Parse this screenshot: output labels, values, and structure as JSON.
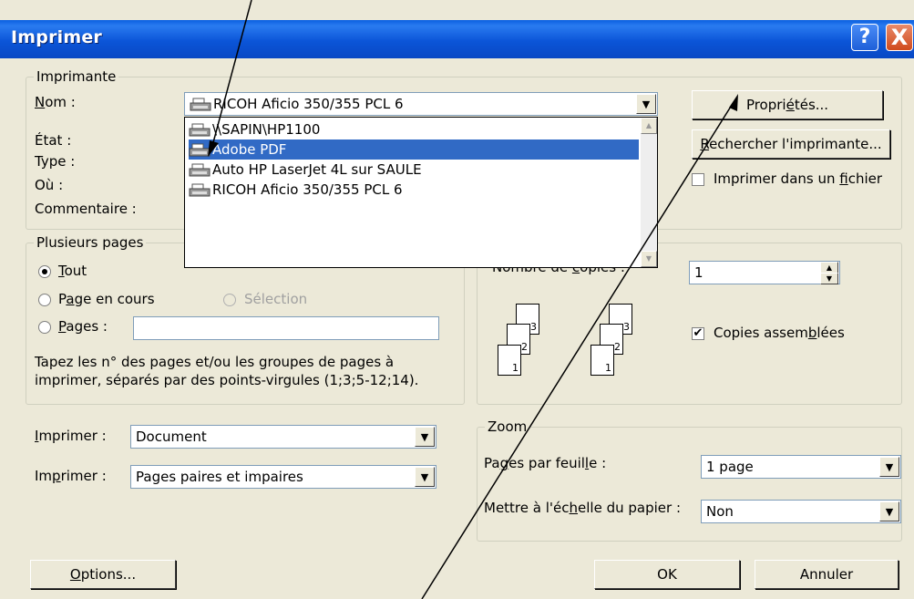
{
  "window": {
    "title": "Imprimer",
    "help": "?",
    "close": "X"
  },
  "printer": {
    "legend": "Imprimante",
    "name_label_u": "N",
    "name_label_rest": "om :",
    "name_value": "RICOH Aficio 350/355 PCL 6",
    "state_label": "État :",
    "type_label": "Type :",
    "where_label": "Où :",
    "comment_label": "Commentaire :",
    "properties_pre": "Propri",
    "properties_u": "é",
    "properties_post": "tés...",
    "find_u": "R",
    "find_rest": "echercher l'imprimante...",
    "print_to_file_pre": "Imprimer dans un ",
    "print_to_file_u": "f",
    "print_to_file_post": "ichier",
    "dropdown_items": [
      {
        "label": "\\\\SAPIN\\HP1100",
        "selected": false
      },
      {
        "label": "Adobe PDF",
        "selected": true
      },
      {
        "label": "Auto HP LaserJet 4L sur SAULE",
        "selected": false
      },
      {
        "label": "RICOH Aficio 350/355 PCL 6",
        "selected": false
      }
    ]
  },
  "pages": {
    "legend": "Plusieurs pages",
    "all_u": "T",
    "all_rest": "out",
    "current_pre": "P",
    "current_u": "a",
    "current_post": "ge en cours",
    "selection": "Sélection",
    "pages_u": "P",
    "pages_rest": "ages :",
    "hint_line1": "Tapez les n° des pages et/ou les groupes de pages à",
    "hint_line2": "imprimer, séparés par des points-virgules (1;3;5-12;14)."
  },
  "copies": {
    "count_label_pre": "Nombre de ",
    "count_label_u": "c",
    "count_label_post": "opies :",
    "count_value": "1",
    "collate_pre": "Copies assem",
    "collate_u": "b",
    "collate_post": "lées",
    "collate_checked": "✔",
    "stack1": [
      "1",
      "2",
      "3"
    ],
    "stack2": [
      "1",
      "2",
      "3"
    ]
  },
  "print_what": {
    "label1_u": "I",
    "label1_rest": "mprimer :",
    "value1": "Document",
    "label2_pre": "Im",
    "label2_u": "p",
    "label2_post": "rimer :",
    "value2": "Pages paires et impaires"
  },
  "zoom": {
    "legend": "Zoom",
    "per_sheet_pre": "Pa",
    "per_sheet_u": "g",
    "per_sheet_mid": "es par feuil",
    "per_sheet_u2": "l",
    "per_sheet_post": "e :",
    "per_sheet_value": "1 page",
    "scale_pre": "Mettre à l'éc",
    "scale_u": "h",
    "scale_post": "elle du papier :",
    "scale_value": "Non"
  },
  "footer": {
    "options_u": "O",
    "options_rest": "ptions...",
    "ok": "OK",
    "cancel": "Annuler"
  },
  "icons": {
    "arrow_down": "▼",
    "arrow_up": "▲",
    "printer_icon": "printer-icon"
  }
}
